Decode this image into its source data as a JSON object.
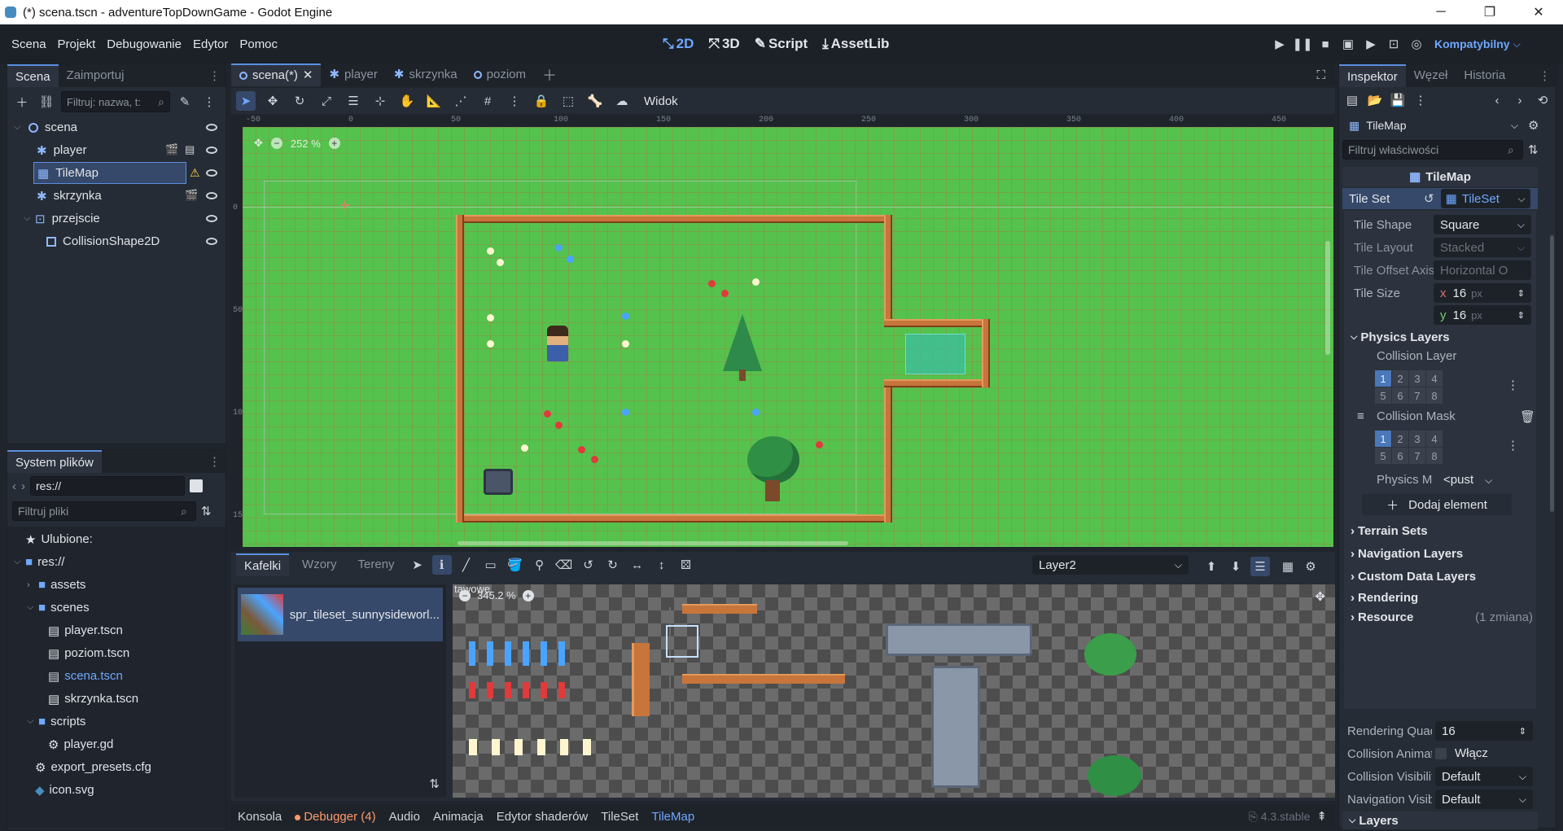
{
  "window": {
    "title": "(*) scena.tscn - adventureTopDownGame - Godot Engine",
    "minimize": "─",
    "maximize": "❐",
    "close": "✕"
  },
  "menubar": {
    "menus": [
      "Scena",
      "Projekt",
      "Debugowanie",
      "Edytor",
      "Pomoc"
    ],
    "modes": [
      {
        "icon": "⤡",
        "label": "2D"
      },
      {
        "icon": "⤧",
        "label": "3D"
      },
      {
        "icon": "✎",
        "label": "Script"
      },
      {
        "icon": "⤓",
        "label": "AssetLib"
      }
    ],
    "renderer": "Kompatybilny",
    "accent": "#6fa8ff"
  },
  "scene_dock": {
    "tabs": [
      "Scena",
      "Zaimportuj"
    ],
    "filter_placeholder": "Filtruj: nazwa, t:",
    "nodes": [
      {
        "label": "scena",
        "icon": "node2d-icon"
      },
      {
        "label": "player",
        "icon": "characterbody-icon"
      },
      {
        "label": "TileMap",
        "icon": "tilemap-icon",
        "selected": true,
        "warning": true
      },
      {
        "label": "skrzynka",
        "icon": "characterbody-icon"
      },
      {
        "label": "przejscie",
        "icon": "area2d-icon"
      },
      {
        "label": "CollisionShape2D",
        "icon": "collisionshape-icon"
      }
    ]
  },
  "filesystem": {
    "title": "System plików",
    "path": "res://",
    "filter_placeholder": "Filtruj pliki",
    "items": [
      {
        "label": "Ulubione:"
      },
      {
        "label": "res://"
      },
      {
        "label": "assets"
      },
      {
        "label": "scenes"
      },
      {
        "label": "player.tscn"
      },
      {
        "label": "poziom.tscn"
      },
      {
        "label": "scena.tscn"
      },
      {
        "label": "skrzynka.tscn"
      },
      {
        "label": "scripts"
      },
      {
        "label": "player.gd"
      },
      {
        "label": "export_presets.cfg"
      },
      {
        "label": "icon.svg"
      }
    ]
  },
  "editor_tabs": [
    "scena(*)",
    "player",
    "skrzynka",
    "poziom"
  ],
  "viewport": {
    "view_menu": "Widok",
    "zoom": "252 %",
    "ruler_labels": [
      "-50",
      "0",
      "50",
      "100",
      "150",
      "200",
      "250",
      "300",
      "350",
      "400",
      "450"
    ],
    "ruler_v_labels": [
      "0",
      "50",
      "100",
      "150"
    ]
  },
  "tile_panel": {
    "tabs": [
      "Kafelki",
      "Wzory",
      "Tereny"
    ],
    "layer": "Layer2",
    "atlas_name": "spr_tileset_sunnysideworl...",
    "atlas_zoom": "345.2 %",
    "overlay_text": "tawowe"
  },
  "bottom_tabs": [
    "Konsola",
    "Debugger (4)",
    "Audio",
    "Animacja",
    "Edytor shaderów",
    "TileSet",
    "TileMap"
  ],
  "version": "4.3.stable",
  "inspector": {
    "tabs": [
      "Inspektor",
      "Węzeł",
      "Historia"
    ],
    "node_name": "TileMap",
    "filter_placeholder": "Filtruj właściwości",
    "header": "TileMap",
    "tile_set": {
      "label": "Tile Set",
      "value": "TileSet"
    },
    "props": [
      {
        "label": "Tile Shape",
        "value": "Square"
      },
      {
        "label": "Tile Layout",
        "value": "Stacked"
      },
      {
        "label": "Tile Offset Axis",
        "value": "Horizontal O"
      },
      {
        "label": "Tile Size",
        "x": "16",
        "y": "16",
        "unit": "px"
      }
    ],
    "physics": {
      "title": "Physics Layers",
      "collision_layer": "Collision Layer",
      "collision_mask": "Collision Mask",
      "physics_material": "Physics M",
      "physics_material_value": "<pust",
      "add_element": "Dodaj element",
      "bits": [
        "1",
        "2",
        "3",
        "4",
        "5",
        "6",
        "7",
        "8"
      ]
    },
    "sections": [
      "Terrain Sets",
      "Navigation Layers",
      "Custom Data Layers",
      "Rendering"
    ],
    "resource": {
      "label": "Resource",
      "changes": "(1 zmiana)"
    },
    "bottom_props": [
      {
        "label": "Rendering Quad",
        "value": "16"
      },
      {
        "label": "Collision Animat",
        "value": "Włącz"
      },
      {
        "label": "Collision Visibilit",
        "value": "Default"
      },
      {
        "label": "Navigation Visib",
        "value": "Default"
      }
    ],
    "layers": "Layers"
  }
}
